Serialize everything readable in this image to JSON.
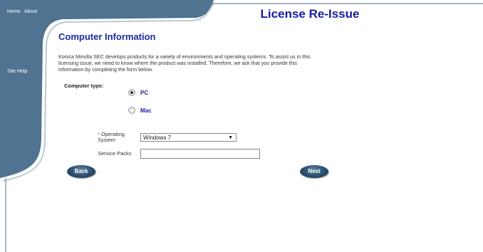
{
  "nav": {
    "home": "Home",
    "about": "About",
    "site_help": "Site Help"
  },
  "header": {
    "title": "License Re-Issue"
  },
  "section": {
    "title": "Computer Information",
    "intro": "Konica Minolta SEC develops products for a variety of environments and operating systems. To assist us in this licensing issue, we need to know where the product was installed. Therefore, we ask that you provide this information by completing the form below."
  },
  "form": {
    "computer_type_label": "Computer type:",
    "options": [
      {
        "label": "PC",
        "checked": true
      },
      {
        "label": "Mac",
        "checked": false
      }
    ],
    "required_marker": "*",
    "os_label": "Operating System",
    "os_value": "Windows 7",
    "sp_label": "Service Packs",
    "sp_value": ""
  },
  "buttons": {
    "back": "Back",
    "next": "Next"
  },
  "colors": {
    "frame": "#4f7391",
    "title": "#1a1aa0",
    "button": "#2a4e6e"
  }
}
